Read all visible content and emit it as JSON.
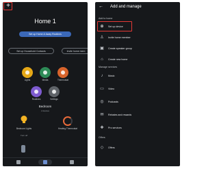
{
  "left_screen": {
    "title": "Home 1",
    "setup_pill": "Set up Home & Away Routines",
    "contacts_pill": "Set up Household Contacts",
    "invite_pill": "Invite home mem",
    "actions": [
      {
        "label": "Lights",
        "color": "#e6a817",
        "icon": "lightbulb-icon"
      },
      {
        "label": "Media",
        "color": "#2e8b57",
        "icon": "music-icon"
      },
      {
        "label": "Thermostat",
        "color": "#d8642c",
        "icon": "thermostat-icon"
      },
      {
        "label": "Routines",
        "color": "#7e5bd0",
        "icon": "routine-icon"
      },
      {
        "label": "Settings",
        "color": "#5f6368",
        "icon": "gear-icon"
      }
    ],
    "section_title": "Bedroom",
    "section_sub": "2 devices",
    "devices": [
      {
        "label": "Bedroom Lights",
        "icon": "lightbulb-icon"
      },
      {
        "label": "Heating Thermostat",
        "icon": "thermostat-icon"
      }
    ],
    "turn_off": "Turn off"
  },
  "right_screen": {
    "title": "Add and manage",
    "group_add": "Add to home",
    "add_items": [
      {
        "label": "Set up device",
        "icon": "add-circle-icon",
        "highlighted": true
      },
      {
        "label": "Invite home member",
        "icon": "person-add-icon",
        "highlighted": false
      },
      {
        "label": "Create speaker group",
        "icon": "speaker-icon",
        "highlighted": false
      },
      {
        "label": "Create new home",
        "icon": "home-icon",
        "highlighted": false
      }
    ],
    "group_services": "Manage services",
    "service_items": [
      {
        "label": "Music",
        "icon": "music-note-icon"
      },
      {
        "label": "Video",
        "icon": "video-icon"
      },
      {
        "label": "Podcasts",
        "icon": "podcast-icon"
      },
      {
        "label": "Rebates and rewards",
        "icon": "rewards-icon"
      },
      {
        "label": "Pro services",
        "icon": "pro-services-icon"
      }
    ],
    "group_offers": "Offers",
    "offer_items": [
      {
        "label": "Offers",
        "icon": "tag-icon"
      }
    ]
  },
  "colors": {
    "highlight": "#e53935",
    "accent_blue": "#3b68b8",
    "screen_bg": "#16181b"
  }
}
